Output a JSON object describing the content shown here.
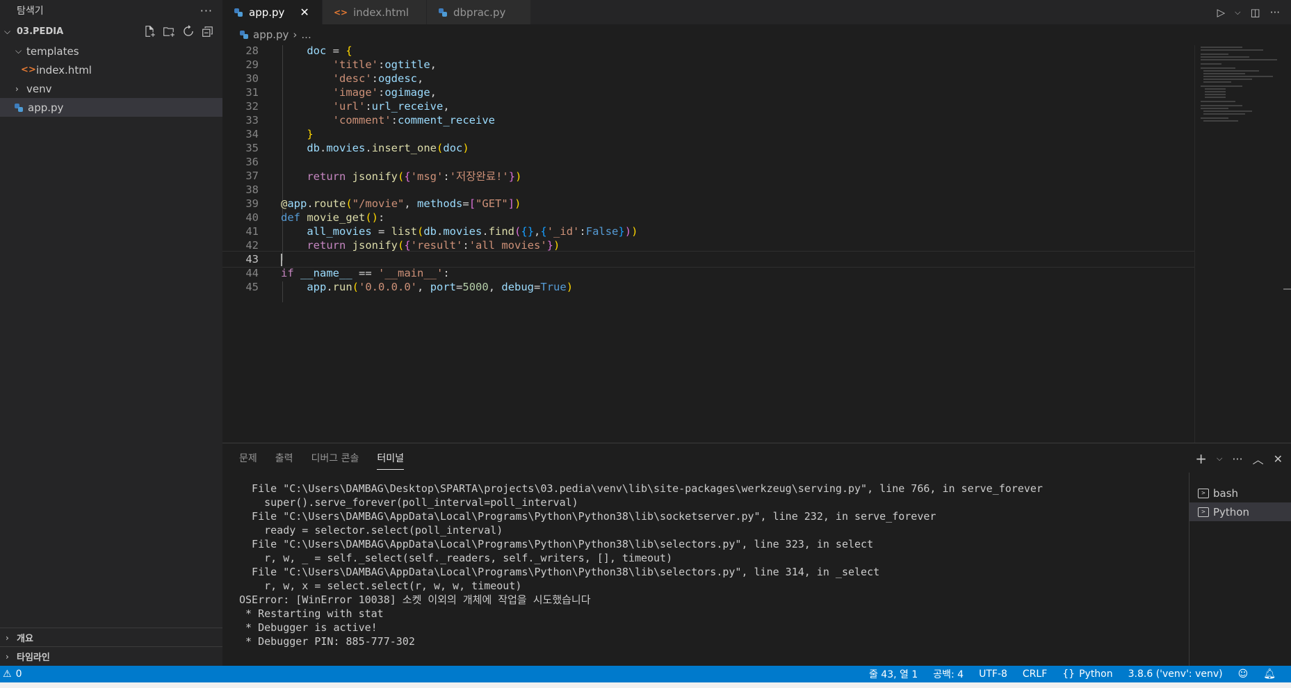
{
  "sidebar": {
    "title": "탐색기",
    "more_icon": "more-icon",
    "project": "03.PEDIA",
    "tree": [
      {
        "label": "templates",
        "kind": "folder",
        "open": true
      },
      {
        "label": "index.html",
        "kind": "html"
      },
      {
        "label": "venv",
        "kind": "folder",
        "open": false
      },
      {
        "label": "app.py",
        "kind": "python"
      }
    ],
    "outline_label": "개요",
    "timeline_label": "타임라인"
  },
  "tabs": [
    {
      "label": "app.py",
      "active": true,
      "icon": "python-icon"
    },
    {
      "label": "index.html",
      "active": false,
      "icon": "html-icon"
    },
    {
      "label": "dbprac.py",
      "active": false,
      "icon": "python-icon"
    }
  ],
  "breadcrumb": {
    "file": "app.py",
    "rest": "..."
  },
  "editor": {
    "line_numbers": [
      "28",
      "29",
      "30",
      "31",
      "32",
      "33",
      "34",
      "35",
      "36",
      "37",
      "38",
      "39",
      "40",
      "41",
      "42",
      "43",
      "44",
      "45"
    ],
    "current_line": "43"
  },
  "panel": {
    "tabs": [
      "문제",
      "출력",
      "디버그 콘솔",
      "터미널"
    ],
    "active_tab": "터미널",
    "terminal_lines": [
      "  File \"C:\\Users\\DAMBAG\\Desktop\\SPARTA\\projects\\03.pedia\\venv\\lib\\site-packages\\werkzeug\\serving.py\", line 766, in serve_forever",
      "    super().serve_forever(poll_interval=poll_interval)",
      "  File \"C:\\Users\\DAMBAG\\AppData\\Local\\Programs\\Python\\Python38\\lib\\socketserver.py\", line 232, in serve_forever",
      "    ready = selector.select(poll_interval)",
      "  File \"C:\\Users\\DAMBAG\\AppData\\Local\\Programs\\Python\\Python38\\lib\\selectors.py\", line 323, in select",
      "    r, w, _ = self._select(self._readers, self._writers, [], timeout)",
      "  File \"C:\\Users\\DAMBAG\\AppData\\Local\\Programs\\Python\\Python38\\lib\\selectors.py\", line 314, in _select",
      "    r, w, x = select.select(r, w, w, timeout)",
      "OSError: [WinError 10038] 소켓 이외의 개체에 작업을 시도했습니다",
      " * Restarting with stat",
      " * Debugger is active!",
      " * Debugger PIN: 885-777-302"
    ],
    "terminals": [
      {
        "label": "bash",
        "active": false
      },
      {
        "label": "Python",
        "active": true
      }
    ]
  },
  "statusbar": {
    "warnings": "0",
    "position": "줄 43, 열 1",
    "spaces": "공백: 4",
    "encoding": "UTF-8",
    "eol": "CRLF",
    "language": "Python",
    "interpreter": "3.8.6 ('venv': venv)"
  },
  "colors": {
    "accent": "#007acc",
    "sidebar_bg": "#252526",
    "editor_bg": "#1e1e1e"
  }
}
